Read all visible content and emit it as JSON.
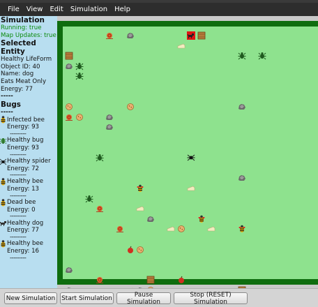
{
  "menu": [
    "File",
    "View",
    "Edit",
    "Simulation",
    "Help"
  ],
  "sidebar": {
    "simulation_heading": "Simulation",
    "running": "Running: true",
    "map_updates": "Map Updates: true",
    "selected_heading": "Selected Entity",
    "selected_lines": [
      "Healthy LifeForm",
      "Object ID: 40",
      "Name: dog",
      "Eats Meat Only",
      "Energy: 77"
    ],
    "divider": "-----",
    "bugs_heading": "Bugs",
    "separator": "---------",
    "bugs": [
      {
        "icon": "bee-icon",
        "name": "Infected bee",
        "energy": "Energy: 93"
      },
      {
        "icon": "bug-icon",
        "name": "Healthy bug",
        "energy": "Energy: 93"
      },
      {
        "icon": "spider-icon",
        "name": "Healthy spider",
        "energy": "Energy: 72"
      },
      {
        "icon": "bee-icon",
        "name": "Healthy bee",
        "energy": "Energy: 13"
      },
      {
        "icon": "bee-icon",
        "name": "Dead bee",
        "energy": "Energy: 0"
      },
      {
        "icon": "dog-icon",
        "name": "Healthy dog",
        "energy": "Energy: 77"
      },
      {
        "icon": "bee-icon",
        "name": "Healthy bee",
        "energy": "Energy: 16"
      }
    ]
  },
  "world": {
    "colors": {
      "border": "#0f6d0f",
      "grass": "#8ee28e",
      "selection": "#e01414"
    },
    "entities": [
      {
        "type": "snail",
        "col": 4,
        "row": 0
      },
      {
        "type": "rock",
        "col": 6,
        "row": 0
      },
      {
        "type": "dog-selected",
        "col": 12,
        "row": 0
      },
      {
        "type": "crate",
        "col": 13,
        "row": 0
      },
      {
        "type": "cheese",
        "col": 11,
        "row": 1
      },
      {
        "type": "crate",
        "col": 0,
        "row": 2
      },
      {
        "type": "bug",
        "col": 17,
        "row": 2
      },
      {
        "type": "bug",
        "col": 19,
        "row": 2
      },
      {
        "type": "rock",
        "col": 0,
        "row": 3
      },
      {
        "type": "bug",
        "col": 1,
        "row": 3
      },
      {
        "type": "bug",
        "col": 1,
        "row": 4
      },
      {
        "type": "cookie",
        "col": 0,
        "row": 7
      },
      {
        "type": "cookie",
        "col": 6,
        "row": 7
      },
      {
        "type": "rock",
        "col": 17,
        "row": 7
      },
      {
        "type": "snail",
        "col": 0,
        "row": 8
      },
      {
        "type": "cookie",
        "col": 1,
        "row": 8
      },
      {
        "type": "rock",
        "col": 4,
        "row": 8
      },
      {
        "type": "rock",
        "col": 4,
        "row": 9
      },
      {
        "type": "bug",
        "col": 3,
        "row": 12
      },
      {
        "type": "spider",
        "col": 12,
        "row": 12
      },
      {
        "type": "rock",
        "col": 17,
        "row": 14
      },
      {
        "type": "bee",
        "col": 7,
        "row": 15
      },
      {
        "type": "cheese",
        "col": 12,
        "row": 15
      },
      {
        "type": "bug",
        "col": 2,
        "row": 16
      },
      {
        "type": "snail",
        "col": 3,
        "row": 17
      },
      {
        "type": "cheese",
        "col": 7,
        "row": 17
      },
      {
        "type": "rock",
        "col": 8,
        "row": 18
      },
      {
        "type": "bee",
        "col": 13,
        "row": 18
      },
      {
        "type": "snail",
        "col": 5,
        "row": 19
      },
      {
        "type": "cheese",
        "col": 10,
        "row": 19
      },
      {
        "type": "cookie",
        "col": 11,
        "row": 19
      },
      {
        "type": "cheese",
        "col": 14,
        "row": 19
      },
      {
        "type": "bee",
        "col": 17,
        "row": 19
      },
      {
        "type": "apple",
        "col": 6,
        "row": 21
      },
      {
        "type": "cookie",
        "col": 7,
        "row": 21
      },
      {
        "type": "rock",
        "col": 0,
        "row": 23
      },
      {
        "type": "snail",
        "col": 3,
        "row": 24
      },
      {
        "type": "crate",
        "col": 8,
        "row": 24
      },
      {
        "type": "apple",
        "col": 11,
        "row": 24
      },
      {
        "type": "rock",
        "col": 0,
        "row": 25
      },
      {
        "type": "cheese",
        "col": 6,
        "row": 25
      },
      {
        "type": "rock",
        "col": 7,
        "row": 25
      },
      {
        "type": "cookie",
        "col": 8,
        "row": 25
      },
      {
        "type": "crate",
        "col": 17,
        "row": 25
      }
    ]
  },
  "buttons": [
    "New Simulation",
    "Start Simulation",
    "Pause Simulation",
    "Stop (RESET) Simulation"
  ]
}
